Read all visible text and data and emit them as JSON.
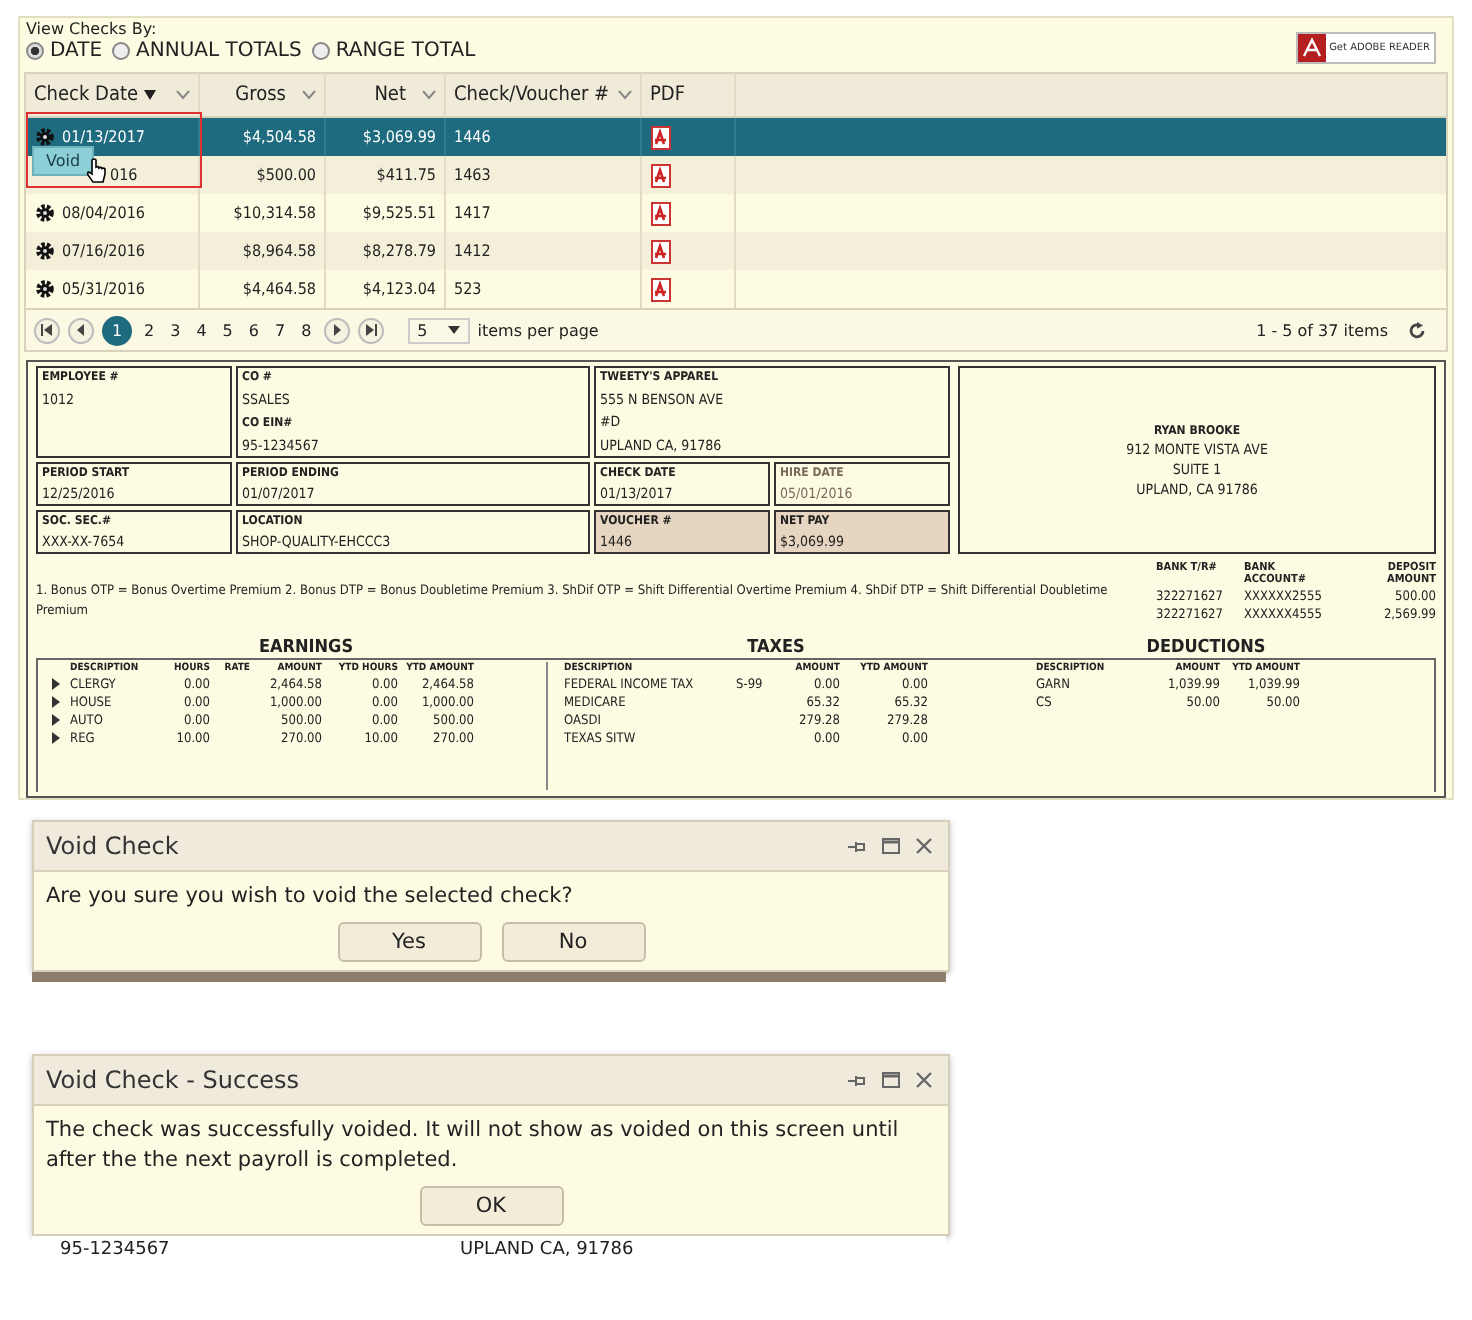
{
  "view_by": {
    "label": "View Checks By:",
    "options": [
      {
        "label": "DATE",
        "selected": true
      },
      {
        "label": "ANNUAL TOTALS",
        "selected": false
      },
      {
        "label": "RANGE TOTAL",
        "selected": false
      }
    ]
  },
  "adobe_badge": {
    "small": "Get",
    "text": "ADOBE READER"
  },
  "grid": {
    "columns": [
      {
        "label": "Check Date",
        "sorted": true
      },
      {
        "label": "Gross",
        "sorted": false
      },
      {
        "label": "Net",
        "sorted": false
      },
      {
        "label": "Check/Voucher #",
        "sorted": false
      },
      {
        "label": "PDF",
        "sorted": false
      }
    ],
    "rows": [
      {
        "date": "01/13/2017",
        "gross": "$4,504.58",
        "net": "$3,069.99",
        "voucher": "1446",
        "selected": true
      },
      {
        "date": "016",
        "gross": "$500.00",
        "net": "$411.75",
        "voucher": "1463",
        "selected": false
      },
      {
        "date": "08/04/2016",
        "gross": "$10,314.58",
        "net": "$9,525.51",
        "voucher": "1417",
        "selected": false
      },
      {
        "date": "07/16/2016",
        "gross": "$8,964.58",
        "net": "$8,278.79",
        "voucher": "1412",
        "selected": false
      },
      {
        "date": "05/31/2016",
        "gross": "$4,464.58",
        "net": "$4,123.04",
        "voucher": "523",
        "selected": false
      }
    ],
    "context_menu": {
      "item": "Void"
    }
  },
  "pager": {
    "pages": [
      {
        "label": "1",
        "selected": true
      },
      {
        "label": "2",
        "selected": false
      },
      {
        "label": "3",
        "selected": false
      },
      {
        "label": "4",
        "selected": false
      },
      {
        "label": "5",
        "selected": false
      },
      {
        "label": "6",
        "selected": false
      },
      {
        "label": "7",
        "selected": false
      },
      {
        "label": "8",
        "selected": false
      }
    ],
    "page_size": "5",
    "page_size_label": "items per page",
    "summary": "1 - 5 of 37 items"
  },
  "stub": {
    "boxes": [
      {
        "shaded": false,
        "lines": [
          {
            "text": "EMPLOYEE #",
            "kind": "label"
          },
          {
            "text": "1012",
            "kind": "value"
          }
        ]
      },
      {
        "shaded": false,
        "lines": [
          {
            "text": "CO #",
            "kind": "label"
          },
          {
            "text": "SSALES",
            "kind": "value"
          },
          {
            "text": "CO EIN#",
            "kind": "label"
          },
          {
            "text": "95-1234567",
            "kind": "value"
          }
        ]
      },
      {
        "shaded": false,
        "lines": [
          {
            "text": "TWEETY'S APPAREL",
            "kind": "label"
          },
          {
            "text": "555 N BENSON AVE",
            "kind": "value"
          },
          {
            "text": "#D",
            "kind": "value"
          },
          {
            "text": "UPLAND  CA, 91786",
            "kind": "value"
          }
        ]
      },
      {
        "shaded": false,
        "lines": [
          {
            "text": "PERIOD START",
            "kind": "label"
          },
          {
            "text": "12/25/2016",
            "kind": "value"
          }
        ]
      },
      {
        "shaded": false,
        "lines": [
          {
            "text": "PERIOD ENDING",
            "kind": "label"
          },
          {
            "text": "01/07/2017",
            "kind": "value"
          }
        ]
      },
      {
        "shaded": false,
        "lines": [
          {
            "text": "CHECK DATE",
            "kind": "label"
          },
          {
            "text": "01/13/2017",
            "kind": "value"
          }
        ]
      },
      {
        "shaded": false,
        "lines": [
          {
            "text": "HIRE DATE",
            "kind": "label"
          },
          {
            "text": "05/01/2016",
            "kind": "value"
          }
        ]
      },
      {
        "shaded": false,
        "lines": [
          {
            "text": "SOC. SEC.#",
            "kind": "label"
          },
          {
            "text": "XXX-XX-7654",
            "kind": "value"
          }
        ]
      },
      {
        "shaded": false,
        "lines": [
          {
            "text": "LOCATION",
            "kind": "label"
          },
          {
            "text": "SHOP-QUALITY-EHCCC3",
            "kind": "value"
          }
        ]
      },
      {
        "shaded": true,
        "lines": [
          {
            "text": "VOUCHER #",
            "kind": "label"
          },
          {
            "text": "1446",
            "kind": "value"
          }
        ]
      },
      {
        "shaded": true,
        "lines": [
          {
            "text": "NET PAY",
            "kind": "label"
          },
          {
            "text": "$3,069.99",
            "kind": "value"
          }
        ]
      },
      {
        "shaded": false,
        "lines": [
          {
            "text": "RYAN BROOKE",
            "kind": "label"
          },
          {
            "text": "912 MONTE VISTA AVE",
            "kind": "value"
          },
          {
            "text": "SUITE 1",
            "kind": "value"
          },
          {
            "text": "UPLAND, CA 91786",
            "kind": "value"
          }
        ]
      }
    ],
    "footnote": "1. Bonus OTP = Bonus Overtime Premium 2. Bonus DTP = Bonus Doubletime Premium 3. ShDif OTP = Shift Differential Overtime Premium 4. ShDif DTP = Shift Differential Doubletime Premium",
    "bank": {
      "columns": [
        "BANK T/R#",
        "BANK ACCOUNT#",
        "DEPOSIT AMOUNT"
      ],
      "rows": [
        [
          "322271627",
          "XXXXXX2555",
          "500.00"
        ],
        [
          "322271627",
          "XXXXXX4555",
          "2,569.99"
        ]
      ]
    },
    "earnings": {
      "title": "EARNINGS",
      "columns": [
        "DESCRIPTION",
        "HOURS",
        "RATE",
        "AMOUNT",
        "YTD HOURS",
        "YTD AMOUNT"
      ],
      "rows": [
        [
          "CLERGY",
          "0.00",
          "",
          "2,464.58",
          "0.00",
          "2,464.58"
        ],
        [
          "HOUSE",
          "0.00",
          "",
          "1,000.00",
          "0.00",
          "1,000.00"
        ],
        [
          "AUTO",
          "0.00",
          "",
          "500.00",
          "0.00",
          "500.00"
        ],
        [
          "REG",
          "10.00",
          "",
          "270.00",
          "10.00",
          "270.00"
        ]
      ]
    },
    "taxes": {
      "title": "TAXES",
      "columns": [
        "DESCRIPTION",
        "",
        "AMOUNT",
        "YTD AMOUNT"
      ],
      "rows": [
        [
          "FEDERAL INCOME TAX",
          "S-99",
          "0.00",
          "0.00"
        ],
        [
          "MEDICARE",
          "",
          "65.32",
          "65.32"
        ],
        [
          "OASDI",
          "",
          "279.28",
          "279.28"
        ],
        [
          "TEXAS SITW",
          "",
          "0.00",
          "0.00"
        ]
      ]
    },
    "deductions": {
      "title": "DEDUCTIONS",
      "columns": [
        "DESCRIPTION",
        "AMOUNT",
        "YTD AMOUNT"
      ],
      "rows": [
        [
          "GARN",
          "1,039.99",
          "1,039.99"
        ],
        [
          "CS",
          "50.00",
          "50.00"
        ]
      ]
    }
  },
  "dialogs": [
    {
      "title": "Void Check",
      "message": "Are you sure you wish to void the selected check?",
      "buttons": [
        "Yes",
        "No"
      ]
    },
    {
      "title": "Void Check - Success",
      "message": "The check was successfully voided. It will not show as voided on this screen until after the the next payroll is completed.",
      "buttons": [
        "OK"
      ]
    }
  ],
  "background_fragments": [
    "95-1234567",
    "UPLAND  CA, 91786"
  ]
}
